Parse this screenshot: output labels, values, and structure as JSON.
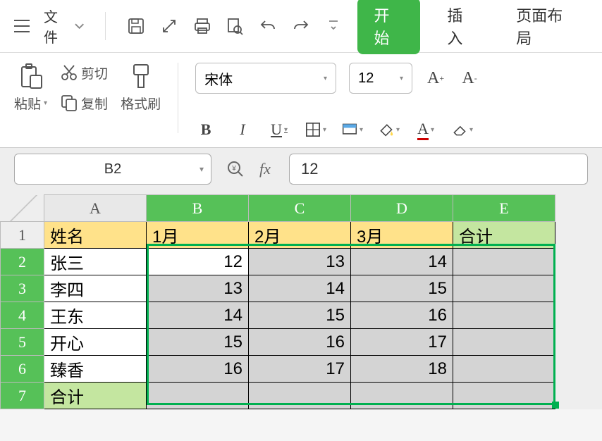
{
  "menubar": {
    "file_label": "文件",
    "tabs": {
      "start": "开始",
      "insert": "插入",
      "layout": "页面布局"
    }
  },
  "ribbon": {
    "paste": "粘贴",
    "cut": "剪切",
    "copy": "复制",
    "format_painter": "格式刷",
    "font_name": "宋体",
    "font_size": "12",
    "bold": "B",
    "italic": "I",
    "underline": "U",
    "increase_font": "A⁺",
    "decrease_font": "A⁻"
  },
  "formula_bar": {
    "name_box": "B2",
    "formula_value": "12"
  },
  "grid": {
    "columns": [
      "A",
      "B",
      "C",
      "D",
      "E"
    ],
    "headers": {
      "name": "姓名",
      "m1": "1月",
      "m2": "2月",
      "m3": "3月",
      "total": "合计"
    },
    "rows": [
      {
        "name": "张三",
        "v": [
          12,
          13,
          14
        ]
      },
      {
        "name": "李四",
        "v": [
          13,
          14,
          15
        ]
      },
      {
        "name": "王东",
        "v": [
          14,
          15,
          16
        ]
      },
      {
        "name": "开心",
        "v": [
          15,
          16,
          17
        ]
      },
      {
        "name": "臻香",
        "v": [
          16,
          17,
          18
        ]
      }
    ],
    "total_label": "合计"
  },
  "chart_data": {
    "type": "table",
    "title": "",
    "columns": [
      "姓名",
      "1月",
      "2月",
      "3月",
      "合计"
    ],
    "rows": [
      [
        "张三",
        12,
        13,
        14,
        null
      ],
      [
        "李四",
        13,
        14,
        15,
        null
      ],
      [
        "王东",
        14,
        15,
        16,
        null
      ],
      [
        "开心",
        15,
        16,
        17,
        null
      ],
      [
        "臻香",
        16,
        17,
        18,
        null
      ],
      [
        "合计",
        null,
        null,
        null,
        null
      ]
    ]
  }
}
